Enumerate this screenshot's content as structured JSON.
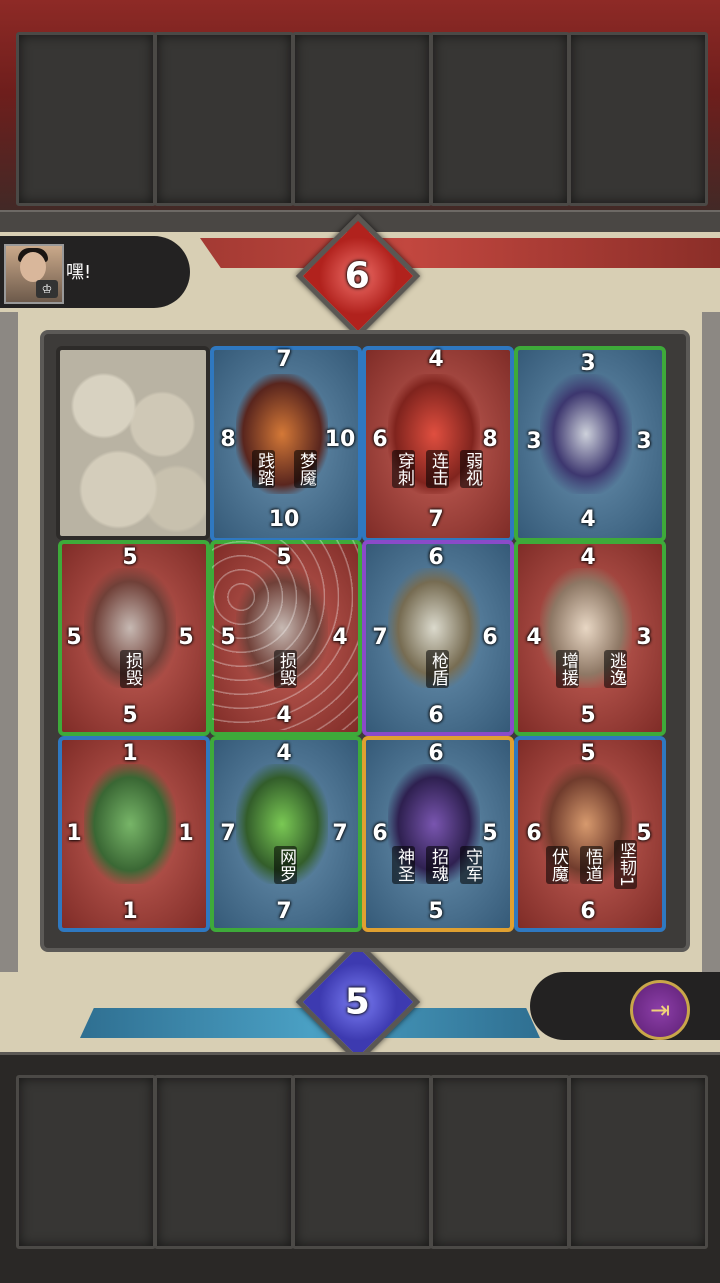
{
  "opponent": {
    "chat": "嘿!",
    "score": "6",
    "avatar_badge": "♔"
  },
  "player": {
    "score": "5",
    "exit_icon": "exit-door-icon"
  },
  "colors": {
    "opponent": "#b1221d",
    "player": "#3d3ab0",
    "blue_owner": "#2f78c0",
    "red_owner": "#c86259"
  },
  "cards": [
    {
      "id": "c1",
      "top": "7",
      "left": "8",
      "right": "10",
      "bottom": "10",
      "skills": [
        "践踏",
        "梦魇"
      ]
    },
    {
      "id": "c2",
      "top": "4",
      "left": "6",
      "right": "8",
      "bottom": "7",
      "skills": [
        "穿刺",
        "连击",
        "弱视"
      ]
    },
    {
      "id": "c3",
      "top": "3",
      "left": "3",
      "right": "3",
      "bottom": "4",
      "skills": []
    },
    {
      "id": "c4",
      "top": "5",
      "left": "5",
      "right": "5",
      "bottom": "5",
      "skills": [
        "损毁"
      ]
    },
    {
      "id": "c5",
      "top": "5",
      "left": "5",
      "right": "4",
      "bottom": "4",
      "skills": [
        "损毁"
      ]
    },
    {
      "id": "c6",
      "top": "6",
      "left": "7",
      "right": "6",
      "bottom": "6",
      "skills": [
        "枪盾"
      ]
    },
    {
      "id": "c7",
      "top": "4",
      "left": "4",
      "right": "3",
      "bottom": "5",
      "skills": [
        "增援",
        "逃逸"
      ]
    },
    {
      "id": "c8",
      "top": "1",
      "left": "1",
      "right": "1",
      "bottom": "1",
      "skills": []
    },
    {
      "id": "c9",
      "top": "4",
      "left": "7",
      "right": "7",
      "bottom": "7",
      "skills": [
        "网罗"
      ]
    },
    {
      "id": "c10",
      "top": "6",
      "left": "6",
      "right": "5",
      "bottom": "5",
      "skills": [
        "神圣",
        "招魂",
        "守军"
      ]
    },
    {
      "id": "c11",
      "top": "5",
      "left": "6",
      "right": "5",
      "bottom": "6",
      "skills": [
        "伏魔",
        "悟道",
        "坚韧1"
      ]
    }
  ]
}
